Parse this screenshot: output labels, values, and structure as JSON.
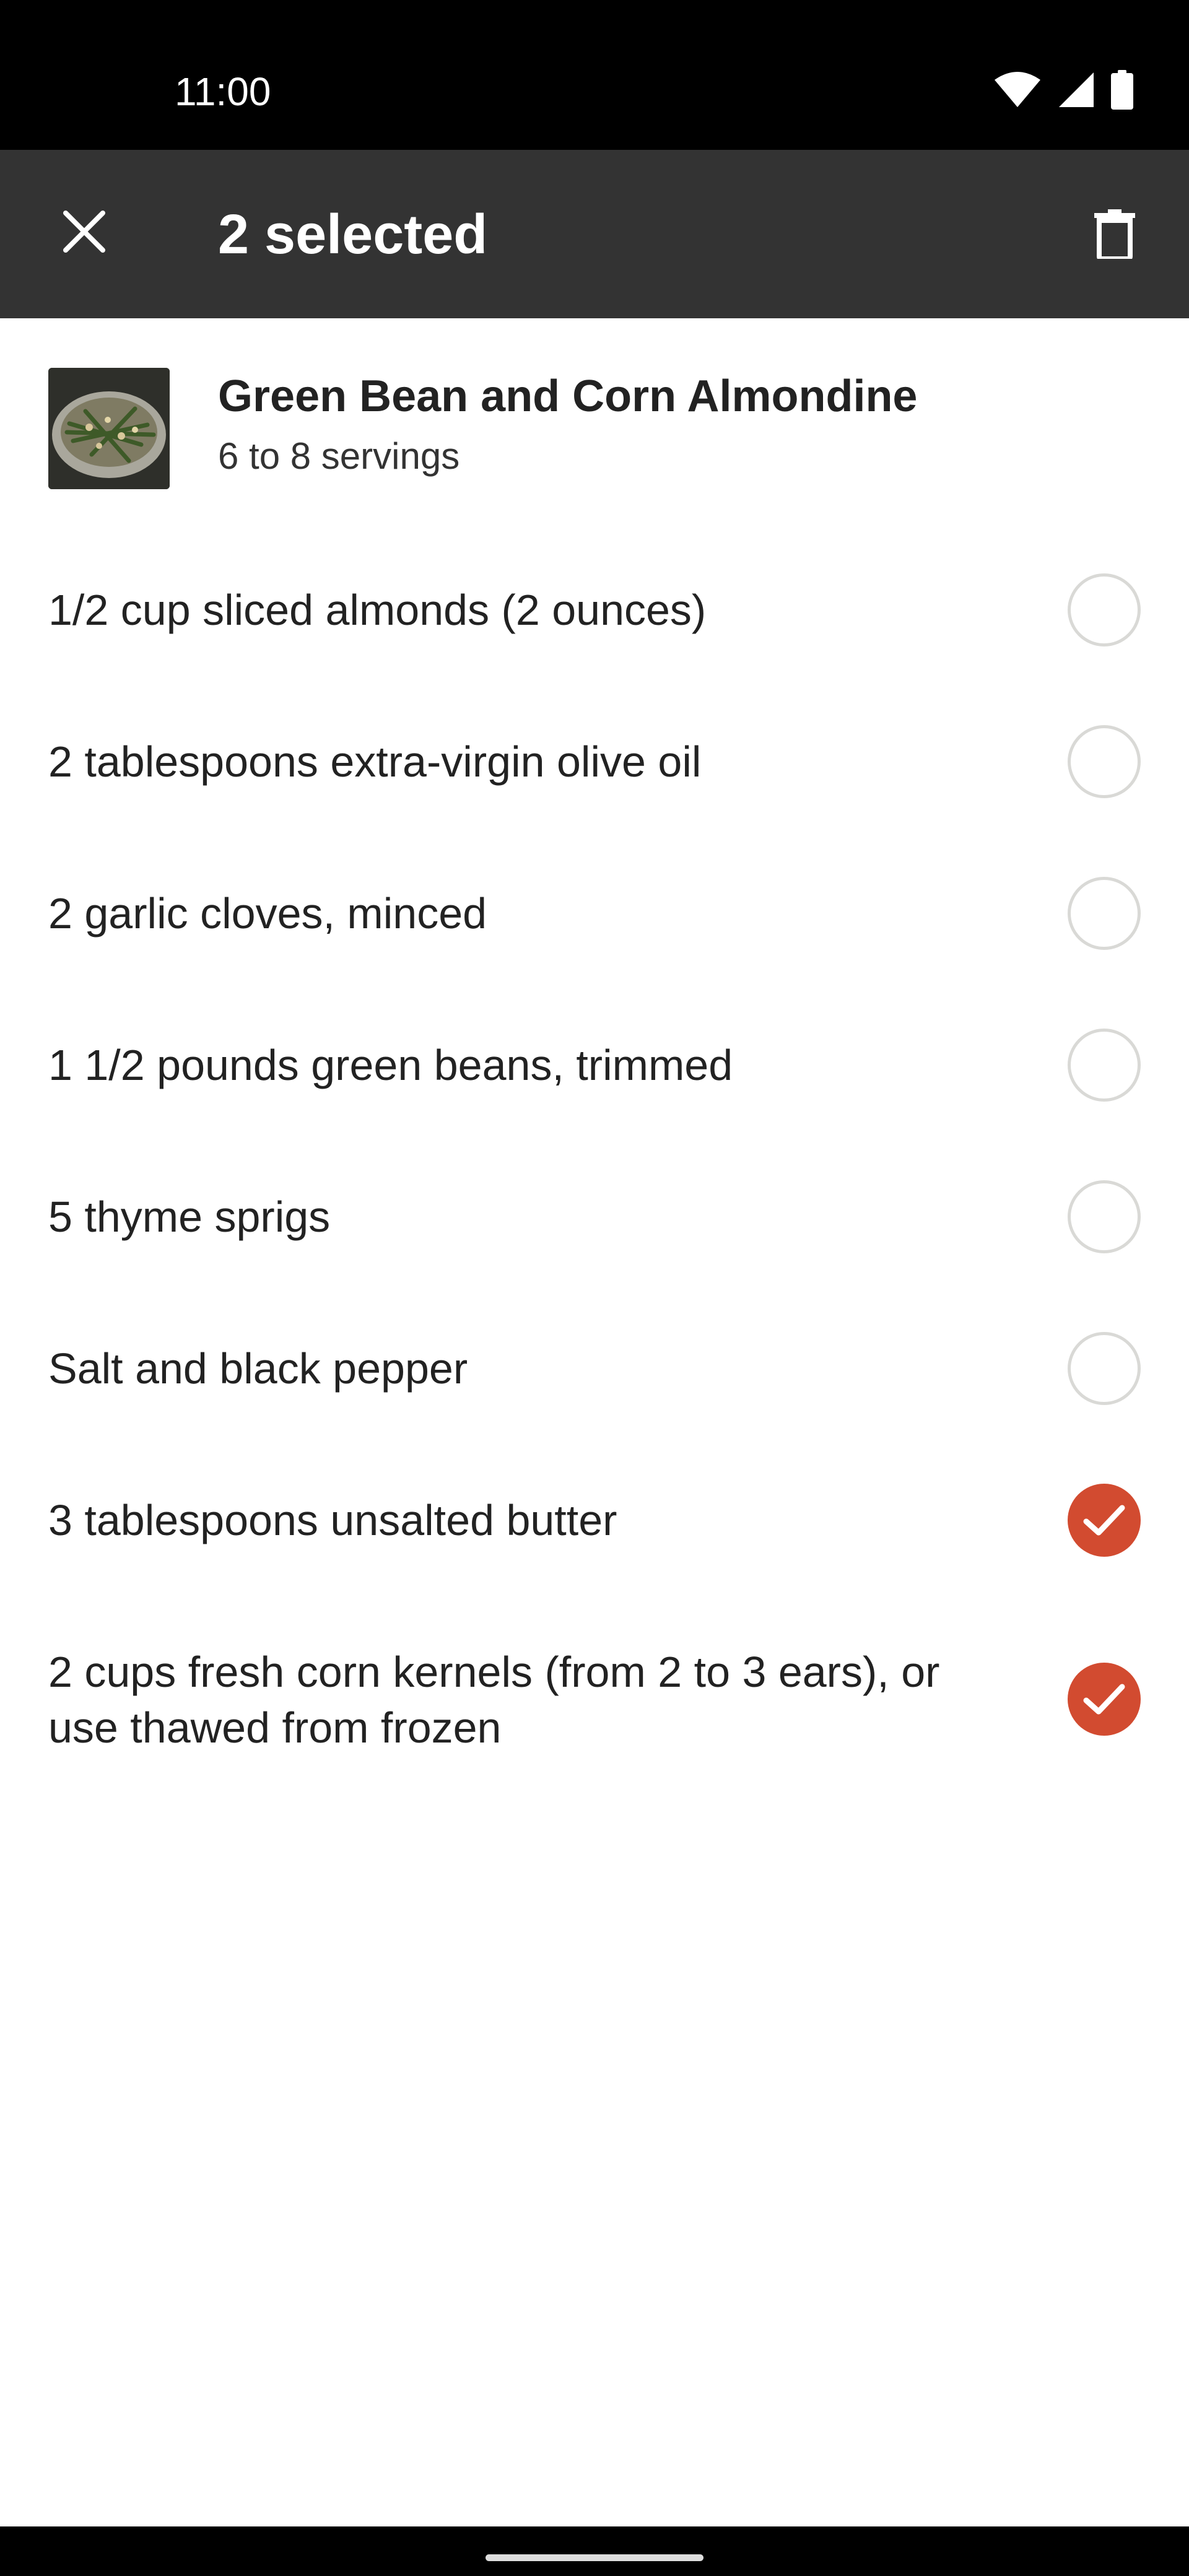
{
  "status_bar": {
    "time": "11:00",
    "icons": [
      "wifi-icon",
      "cell-signal-icon",
      "battery-icon"
    ]
  },
  "action_bar": {
    "title": "2 selected",
    "close_icon": "close-icon",
    "delete_icon": "trash-icon"
  },
  "recipe": {
    "title": "Green Bean and Corn Almondine",
    "servings": "6 to 8 servings"
  },
  "ingredients": [
    {
      "text": "1/2 cup sliced almonds (2 ounces)",
      "selected": false
    },
    {
      "text": "2 tablespoons extra-virgin olive oil",
      "selected": false
    },
    {
      "text": "2 garlic cloves, minced",
      "selected": false
    },
    {
      "text": "1 1/2 pounds green beans, trimmed",
      "selected": false
    },
    {
      "text": "5 thyme sprigs",
      "selected": false
    },
    {
      "text": "Salt and black pepper",
      "selected": false
    },
    {
      "text": "3 tablespoons unsalted butter",
      "selected": true
    },
    {
      "text": "2 cups fresh corn kernels (from 2 to 3 ears), or use thawed from frozen",
      "selected": true
    }
  ],
  "colors": {
    "accent": "#d24b30",
    "action_bar": "#333333",
    "unchecked_border": "#d9d9d6"
  }
}
